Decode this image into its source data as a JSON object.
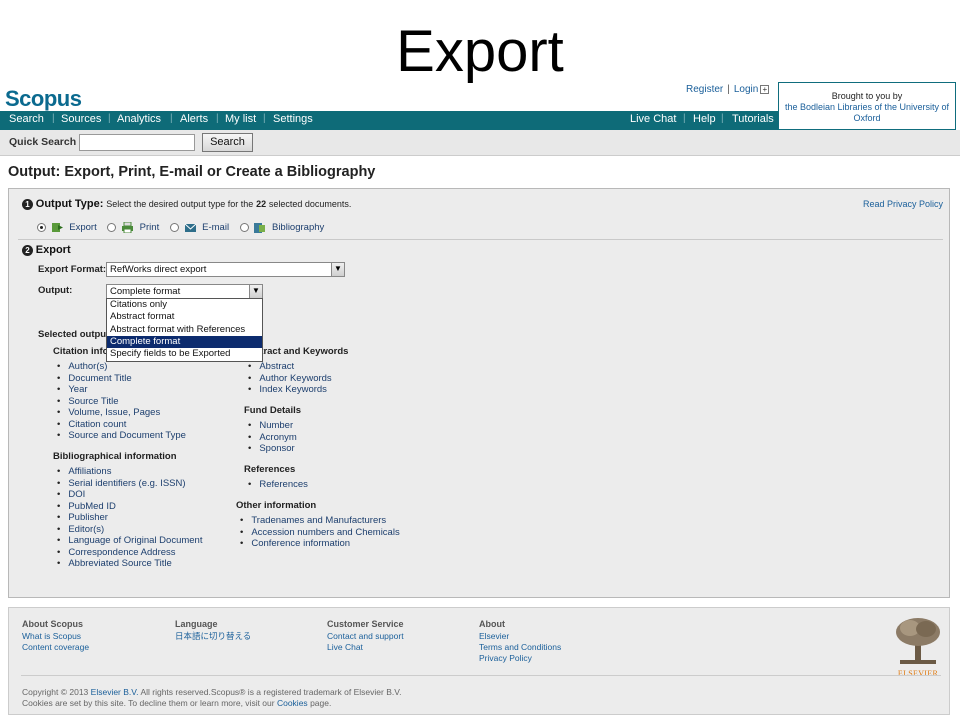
{
  "slide_title": "Export",
  "header": {
    "logo": "Scopus",
    "register": "Register",
    "login": "Login",
    "brought_line1": "Brought to you by",
    "brought_line2": "the Bodleian Libraries of the University of Oxford"
  },
  "nav": {
    "left": [
      "Search",
      "Sources",
      "Analytics",
      "Alerts",
      "My list",
      "Settings"
    ],
    "right": [
      "Live Chat",
      "Help",
      "Tutorials"
    ]
  },
  "quick_search": {
    "label": "Quick Search",
    "value": "",
    "button": "Search"
  },
  "page_title": "Output: Export, Print, E-mail or Create a Bibliography",
  "section1": {
    "number": "1",
    "title": "Output Type:",
    "desc_prefix": "Select the desired output type for the",
    "count": "22",
    "desc_suffix": "selected documents.",
    "privacy": "Read Privacy Policy",
    "options": [
      {
        "label": "Export",
        "selected": true,
        "icon": "export-icon"
      },
      {
        "label": "Print",
        "selected": false,
        "icon": "printer-icon"
      },
      {
        "label": "E-mail",
        "selected": false,
        "icon": "envelope-icon"
      },
      {
        "label": "Bibliography",
        "selected": false,
        "icon": "bibliography-icon"
      }
    ]
  },
  "section2": {
    "number": "2",
    "title": "Export",
    "export_format_label": "Export Format:",
    "export_format_value": "RefWorks direct export",
    "output_label": "Output:",
    "output_value": "Complete format",
    "output_options": [
      "Citations only",
      "Abstract format",
      "Abstract format with References",
      "Complete format",
      "Specify fields to be Exported"
    ],
    "output_selected_index": 3,
    "selected_output_label": "Selected output",
    "citation_info_label": "Citation infor",
    "groups_left": [
      {
        "title": "",
        "items": [
          "Author(s)",
          "Document Title",
          "Year",
          "Source Title",
          "Volume, Issue, Pages",
          "Citation count",
          "Source and Document Type"
        ]
      },
      {
        "title": "Bibliographical information",
        "items": [
          "Affiliations",
          "Serial identifiers (e.g. ISSN)",
          "DOI",
          "PubMed ID",
          "Publisher",
          "Editor(s)",
          "Language of Original Document",
          "Correspondence Address",
          "Abbreviated Source Title"
        ]
      }
    ],
    "groups_right": [
      {
        "title": "stract and Keywords",
        "items": [
          "Abstract",
          "Author Keywords",
          "Index Keywords"
        ]
      },
      {
        "title": "Fund Details",
        "items": [
          "Number",
          "Acronym",
          "Sponsor"
        ]
      },
      {
        "title": "References",
        "items": [
          "References"
        ]
      }
    ],
    "other_info": {
      "title": "Other information",
      "items": [
        "Tradenames and Manufacturers",
        "Accession numbers and Chemicals",
        "Conference information"
      ]
    }
  },
  "footer": {
    "cols": [
      {
        "head": "About Scopus",
        "links": [
          "What is Scopus",
          "Content coverage"
        ]
      },
      {
        "head": "Language",
        "links": [
          "日本語に切り替える"
        ]
      },
      {
        "head": "Customer Service",
        "links": [
          "Contact and support",
          "Live Chat"
        ]
      },
      {
        "head": "About",
        "links": [
          "Elsevier",
          "Terms and Conditions",
          "Privacy Policy"
        ]
      }
    ],
    "copyright_pre": "Copyright © 2013",
    "copyright_link": "Elsevier B.V.",
    "copyright_post": "All rights reserved.Scopus® is a registered trademark of Elsevier B.V.",
    "cookies_pre": "Cookies are set by this site. To decline them or learn more, visit our",
    "cookies_link": "Cookies",
    "cookies_post": "page.",
    "elsevier": "ELSEVIER"
  }
}
